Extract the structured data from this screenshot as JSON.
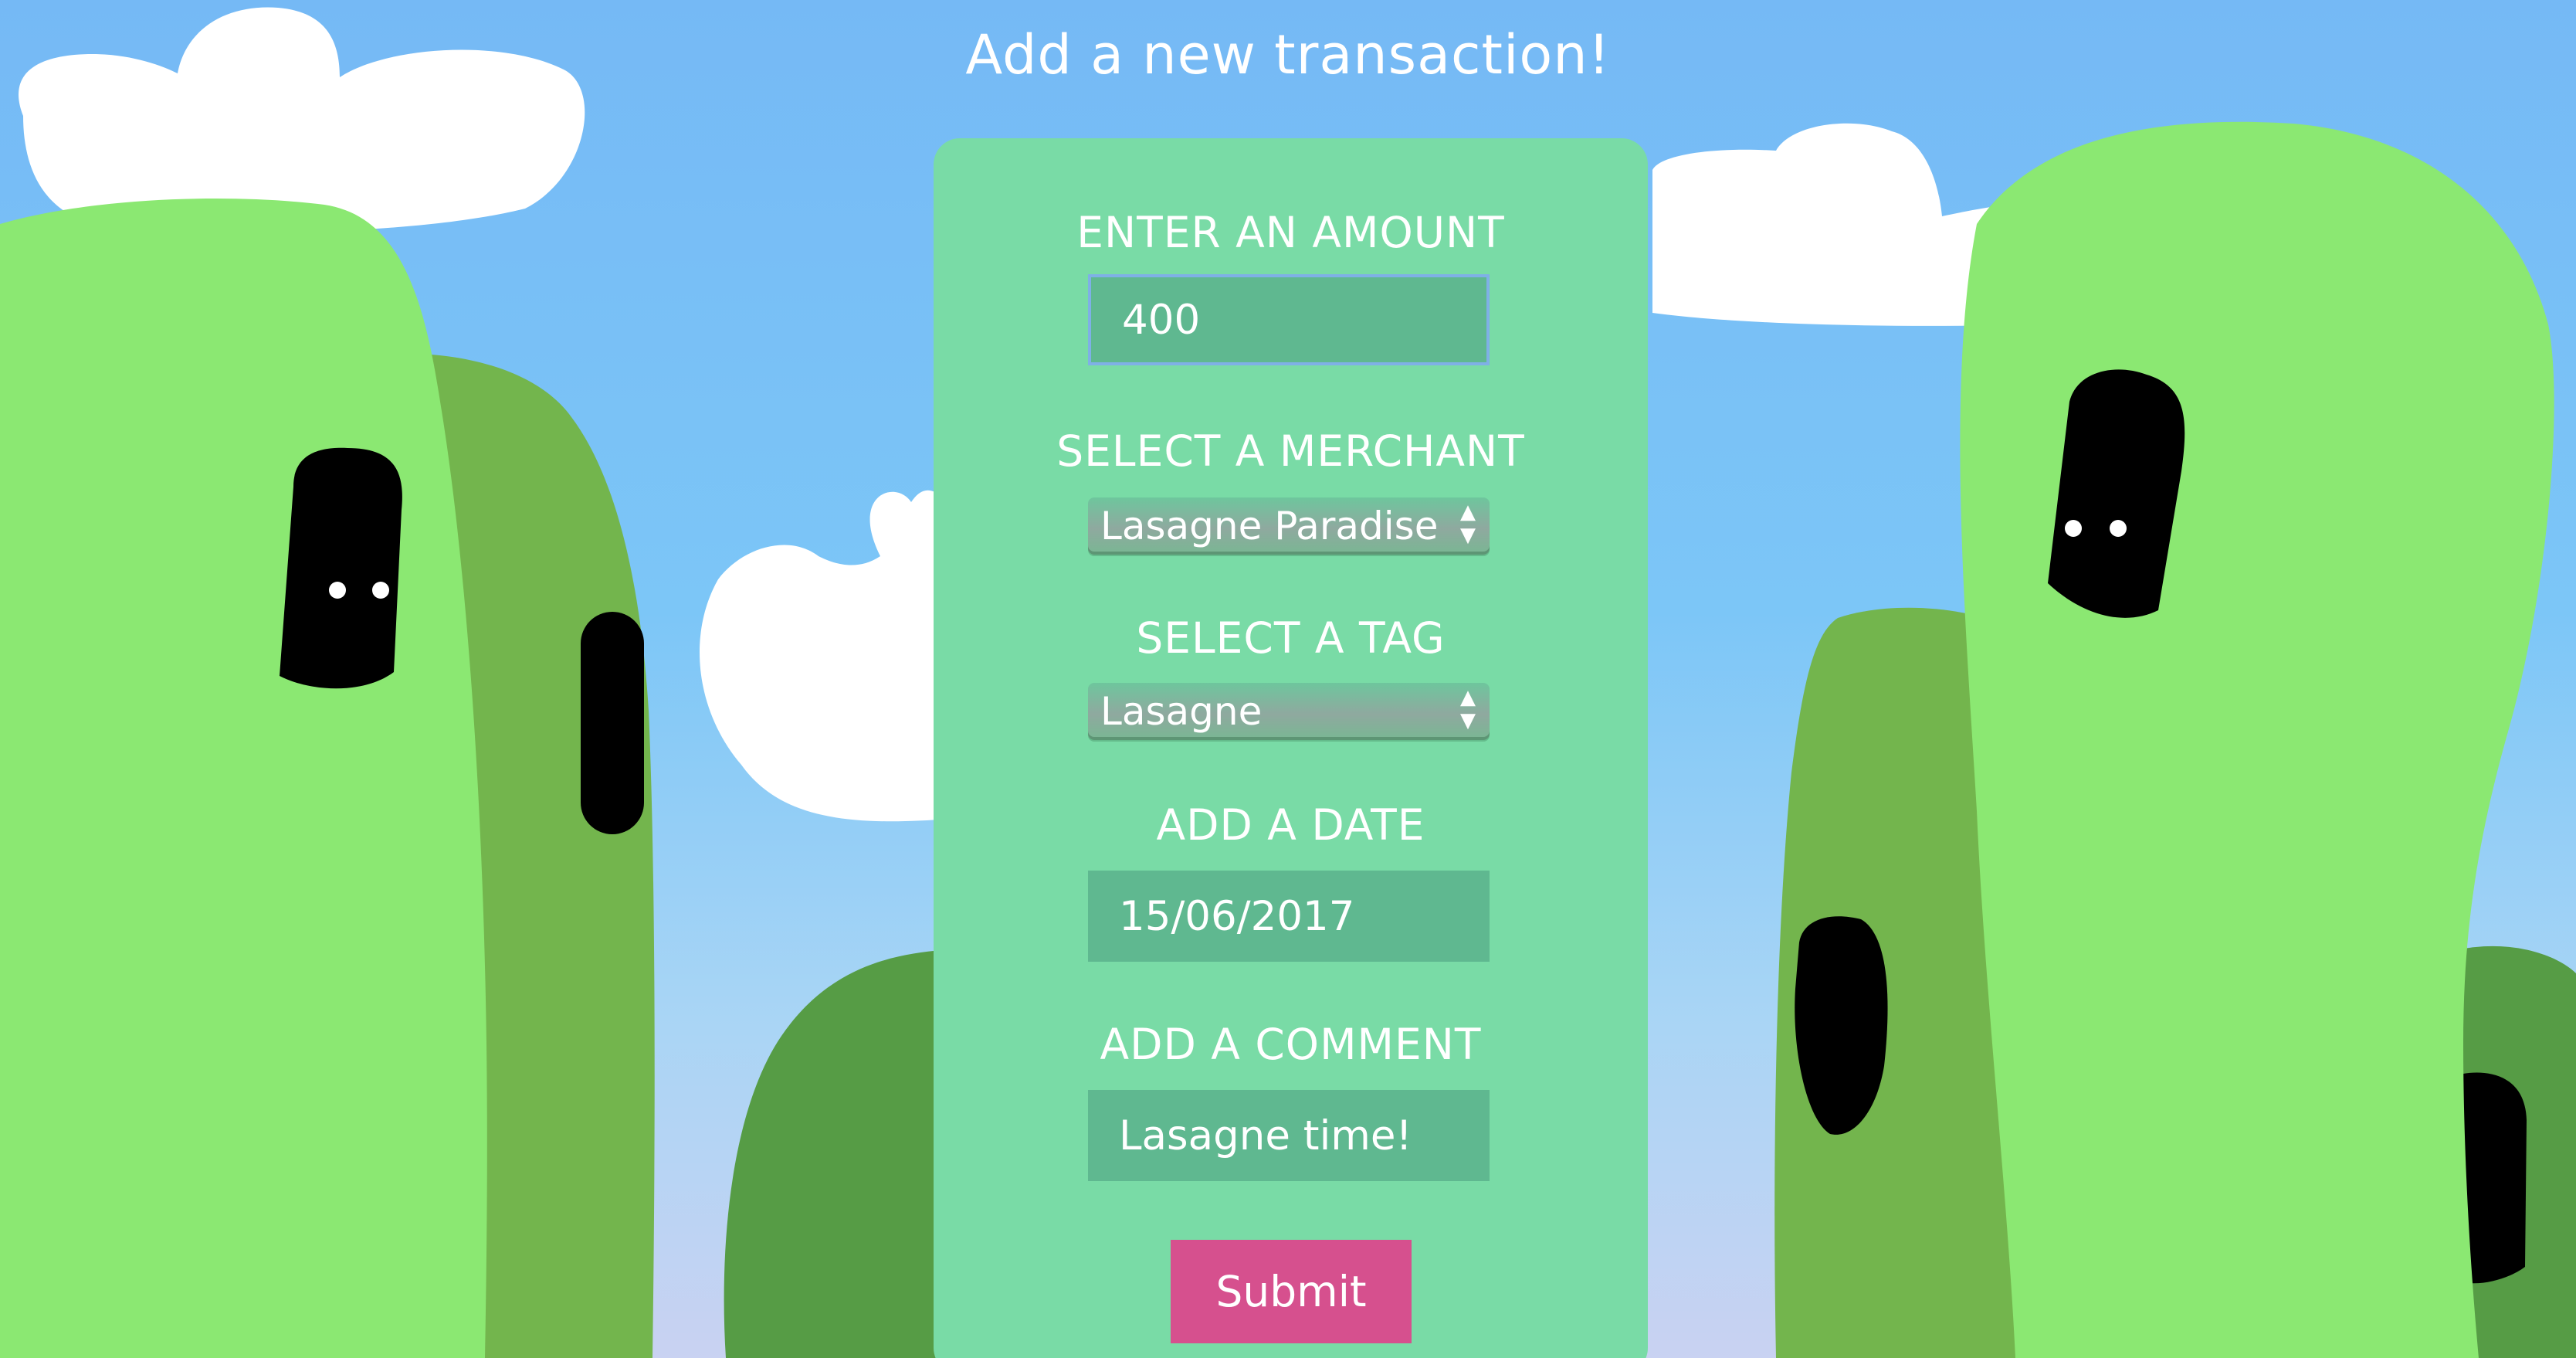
{
  "header": {
    "title": "Add a new transaction!"
  },
  "form": {
    "amount": {
      "label": "ENTER AN AMOUNT",
      "value": "400"
    },
    "merchant": {
      "label": "SELECT A MERCHANT",
      "value": "Lasagne Paradise"
    },
    "tag": {
      "label": "SELECT A TAG",
      "value": "Lasagne"
    },
    "date": {
      "label": "ADD A DATE",
      "value": "15/06/2017"
    },
    "comment": {
      "label": "ADD A COMMENT",
      "value": "Lasagne time!"
    },
    "submit_label": "Submit"
  },
  "colors": {
    "sky_top": "#75b9f5",
    "card": "#79dba6",
    "field": "#5fb890",
    "submit": "#d6508e",
    "creature_light": "#8be872",
    "creature_mid": "#73b54d",
    "creature_dark": "#569c45"
  }
}
